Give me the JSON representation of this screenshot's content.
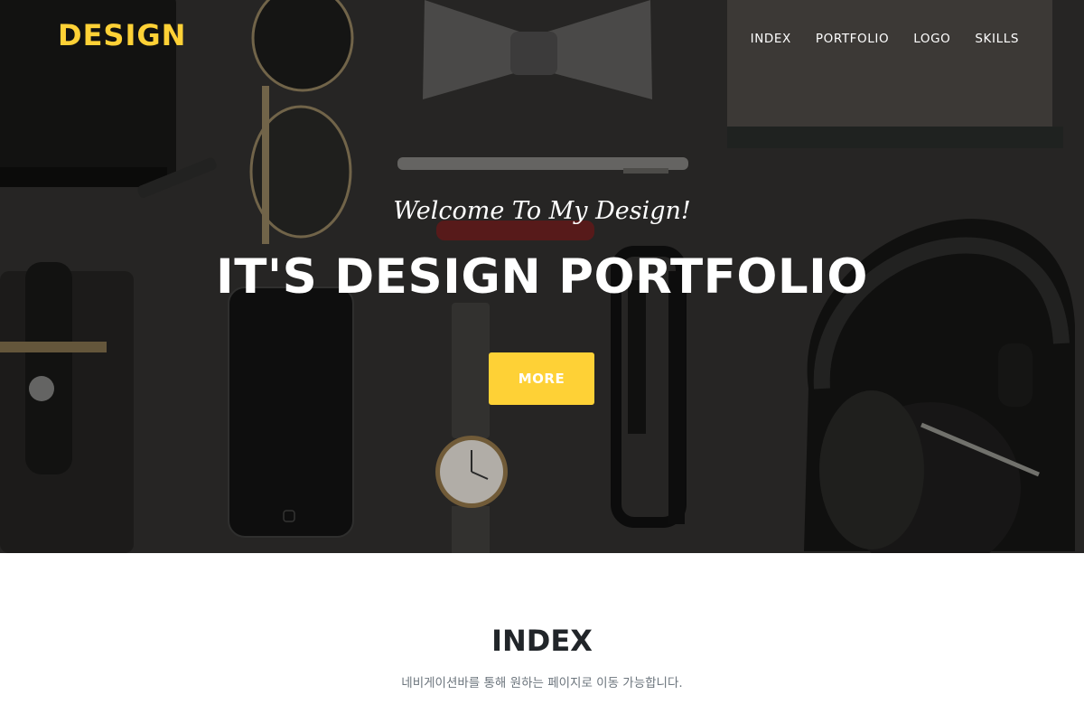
{
  "header": {
    "brand": "DESIGN",
    "nav": [
      {
        "label": "INDEX"
      },
      {
        "label": "PORTFOLIO"
      },
      {
        "label": "LOGO"
      },
      {
        "label": "SKILLS"
      }
    ]
  },
  "hero": {
    "subtitle": "Welcome To My Design!",
    "title": "IT'S DESIGN PORTFOLIO",
    "button_label": "MORE",
    "background_image": "flat-lay-of-accessories"
  },
  "index_section": {
    "title": "INDEX",
    "description": "네비게이션바를 통해 원하는 페이지로 이동 가능합니다."
  },
  "colors": {
    "accent": "#fed136",
    "hero_bg": "#2b2a29",
    "text_dark": "#212529",
    "text_muted": "#6c757d"
  }
}
